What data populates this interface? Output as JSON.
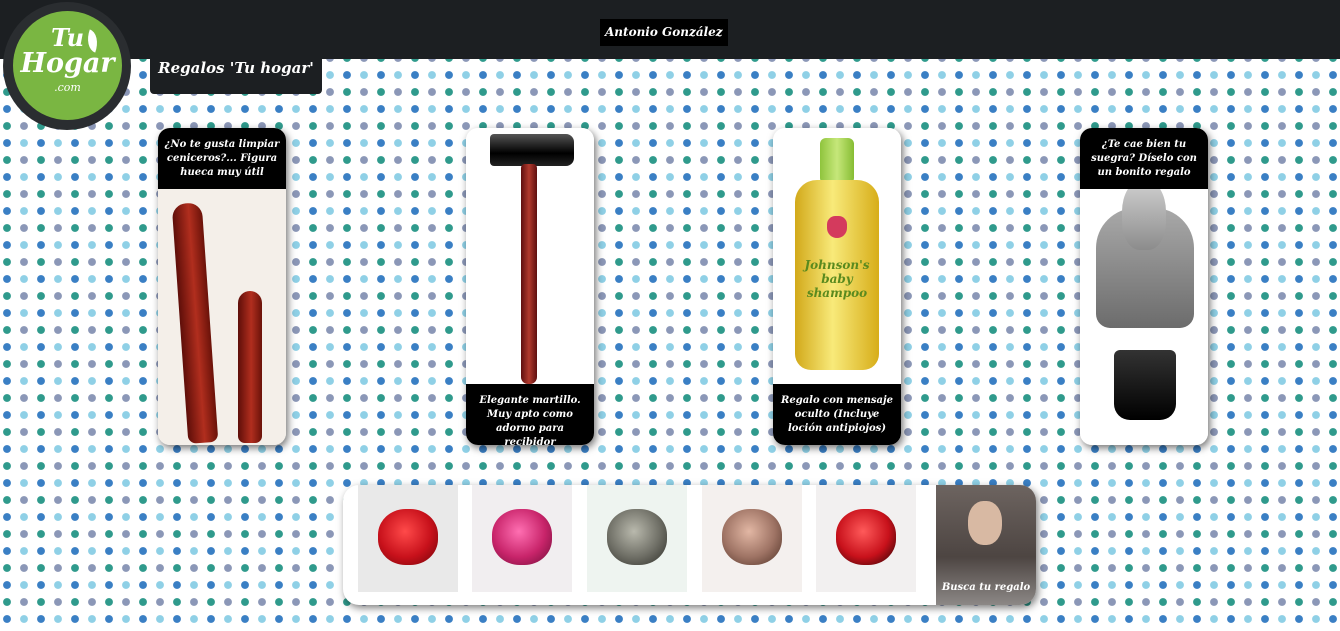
{
  "header": {
    "user_name": "Antonio González"
  },
  "logo": {
    "line1": "Tu",
    "line2": "Hogar",
    "line3": ".com",
    "color": "#7ab642"
  },
  "section": {
    "title": "Regalos 'Tu hogar'"
  },
  "products": [
    {
      "caption": "¿No te gusta limpiar ceniceros?... Figura hueca muy útil",
      "caption_position": "top",
      "icon": "vase-image"
    },
    {
      "caption": "Elegante martillo. Muy apto como adorno para recibidor",
      "caption_position": "bottom",
      "icon": "hammer-image"
    },
    {
      "caption": "Regalo con mensaje oculto (Incluye loción antipiojos)",
      "caption_position": "bottom",
      "icon": "shampoo-image"
    },
    {
      "caption": "¿Te cae bien tu suegra? Díselo con un bonito regalo",
      "caption_position": "top",
      "icon": "bust-image"
    }
  ],
  "shampoo_brand": "Johnson's baby shampoo",
  "roses": [
    {
      "color": "#c8111b"
    },
    {
      "color": "#c8246a"
    },
    {
      "color": "#6f6f66"
    },
    {
      "color": "#9e7364"
    },
    {
      "color": "#c8111b"
    }
  ],
  "search": {
    "label": "Busca tu regalo"
  }
}
